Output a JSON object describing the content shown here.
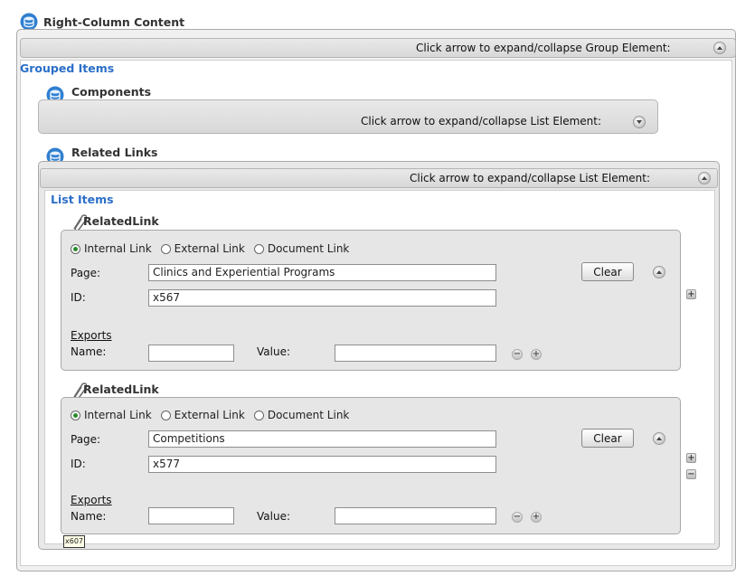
{
  "right_column": {
    "title": "Right-Column Content",
    "hint": "Click arrow to expand/collapse Group Element:",
    "grouped_title": "Grouped Items"
  },
  "components": {
    "title": "Components",
    "hint": "Click arrow to expand/collapse List Element:"
  },
  "related_links": {
    "title": "Related Links",
    "hint": "Click arrow to expand/collapse List Element:",
    "list_items_title": "List Items"
  },
  "links": [
    {
      "title": "RelatedLink",
      "radio_options": [
        "Internal Link",
        "External Link",
        "Document Link"
      ],
      "selected": "Internal Link",
      "page_label": "Page:",
      "page_value": "Clinics and Experiential Programs",
      "id_label": "ID:",
      "id_value": "x567",
      "clear_label": "Clear",
      "exports_label": "Exports",
      "name_label": "Name:",
      "value_label": "Value:"
    },
    {
      "title": "RelatedLink",
      "radio_options": [
        "Internal Link",
        "External Link",
        "Document Link"
      ],
      "selected": "Internal Link",
      "page_label": "Page:",
      "page_value": "Competitions",
      "id_label": "ID:",
      "id_value": "x577",
      "clear_label": "Clear",
      "exports_label": "Exports",
      "name_label": "Name:",
      "value_label": "Value:"
    }
  ],
  "tooltip": "x607",
  "icons": {
    "group": "database-icon",
    "link": "paperclip-icon",
    "expand": "chevron-up-icon",
    "collapse": "chevron-down-icon"
  }
}
